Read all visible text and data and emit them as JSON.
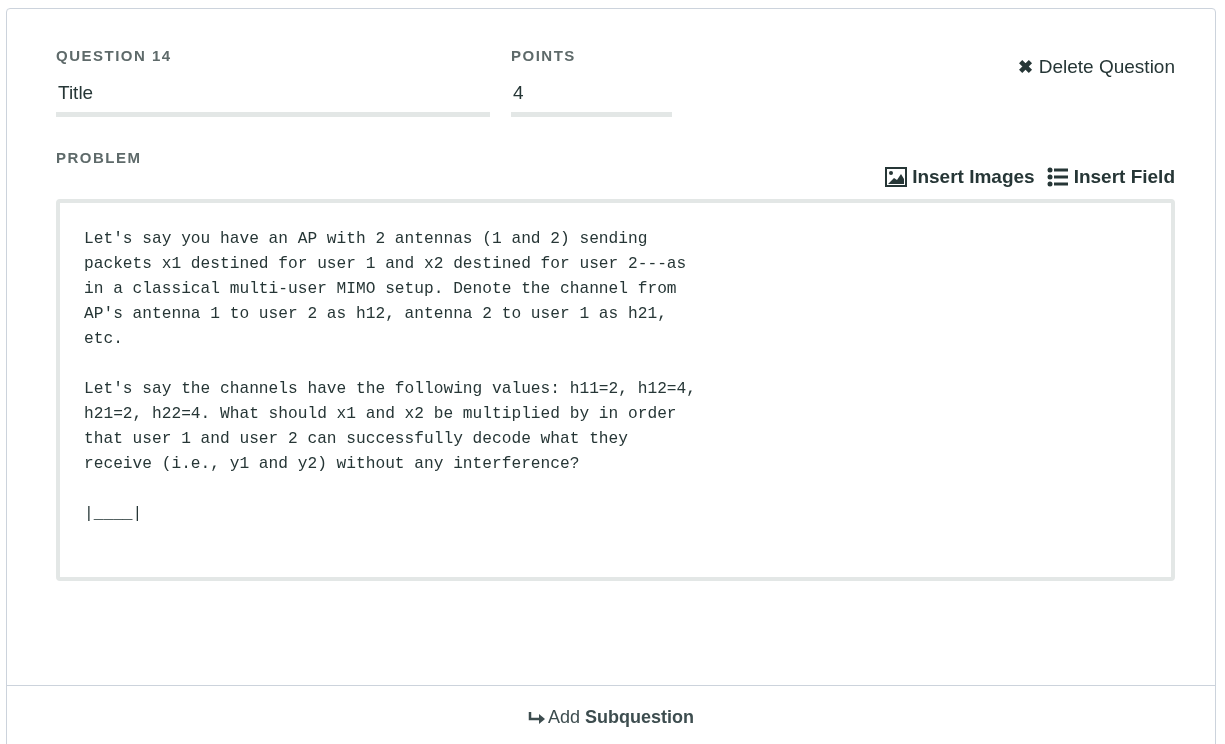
{
  "question": {
    "label": "QUESTION 14",
    "title": {
      "value": "Title"
    }
  },
  "points": {
    "label": "POINTS",
    "value": "4"
  },
  "delete_button": {
    "icon": "✖",
    "label": "Delete Question"
  },
  "problem": {
    "label": "PROBLEM",
    "actions": [
      {
        "kind": "image",
        "label": "Insert Images"
      },
      {
        "kind": "list",
        "label": "Insert Field"
      }
    ],
    "paragraphs": [
      "Let's say you have an AP with 2 antennas (1 and 2) sending packets x1 destined for user 1 and x2 destined for user 2---as in a classical multi-user MIMO setup. Denote the channel from AP's antenna 1 to user 2 as h12, antenna 2 to user 1 as h21, etc.",
      "Let's say the channels have the following values: h11=2, h12=4, h21=2, h22=4. What should x1 and x2 be multiplied by in order that user 1 and user 2 can successfully decode what they receive (i.e., y1 and y2) without any interference?",
      "|____|"
    ]
  },
  "add_subquestion": {
    "text": "Add **Subquestion**"
  }
}
